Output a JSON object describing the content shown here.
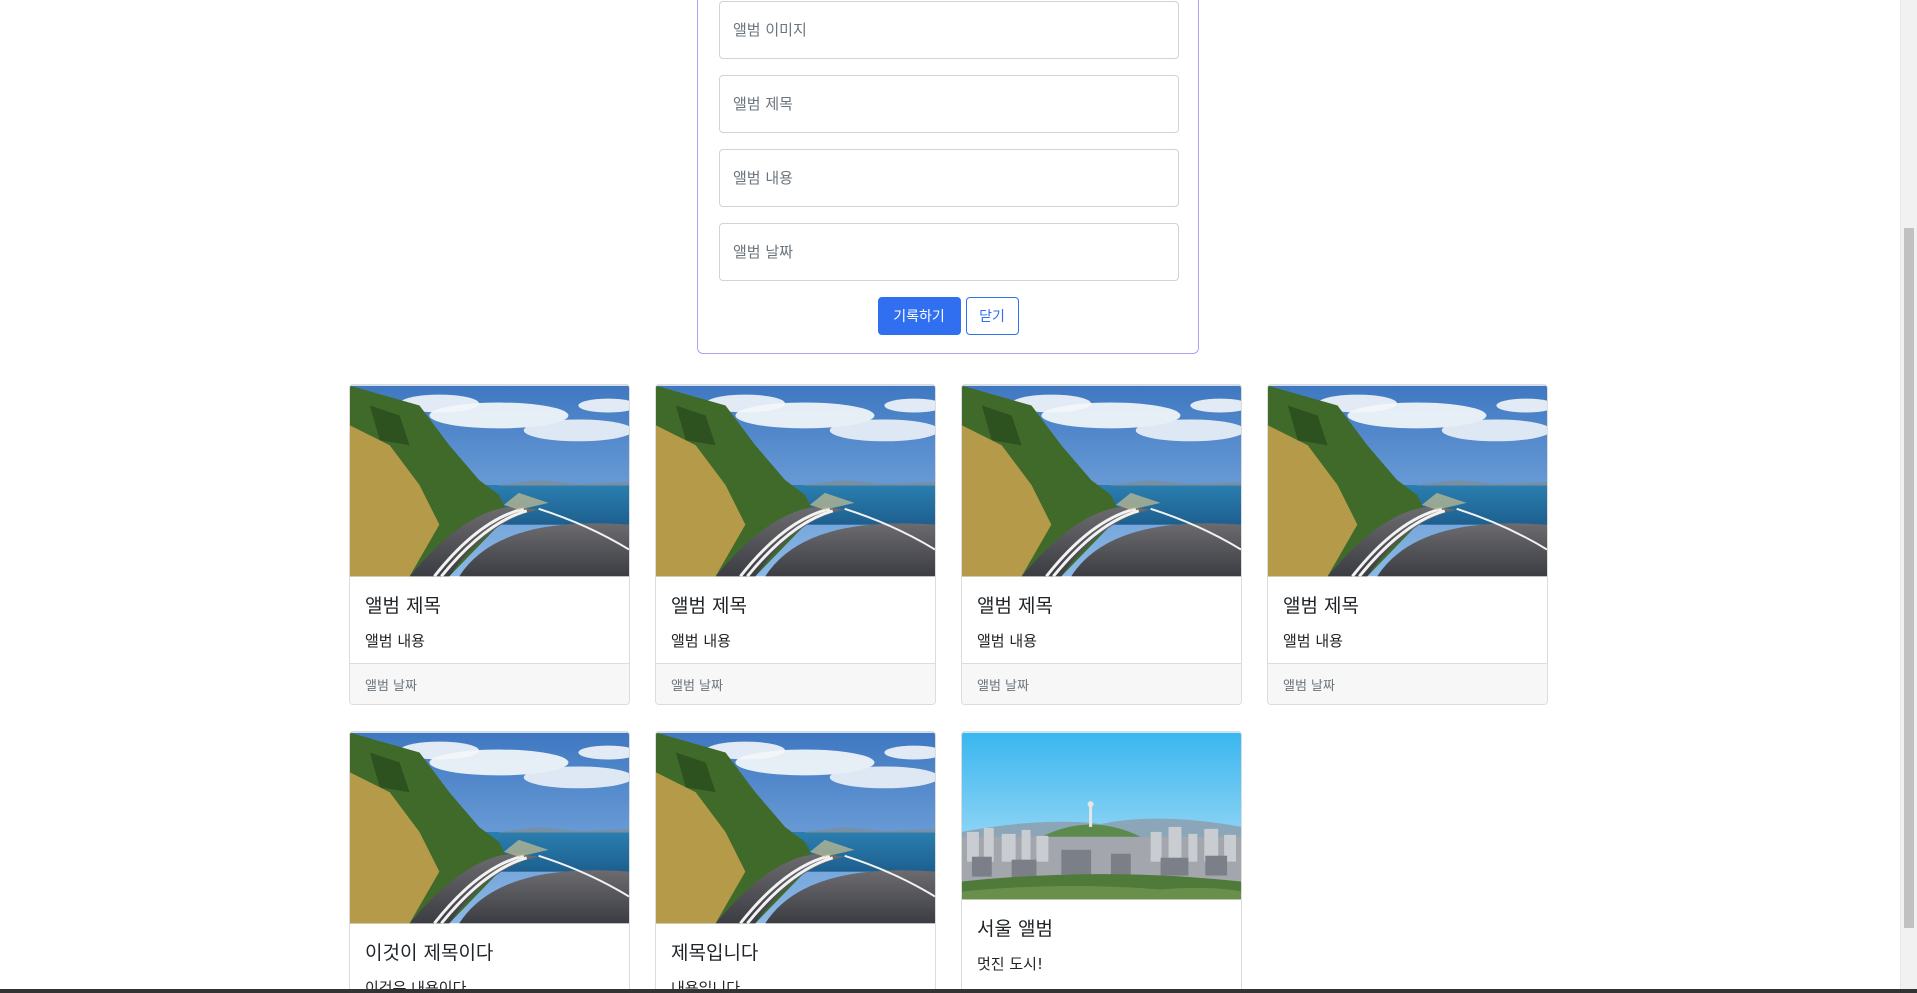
{
  "form": {
    "image_placeholder": "앨범 이미지",
    "title_placeholder": "앨범 제목",
    "content_placeholder": "앨범 내용",
    "date_placeholder": "앨범 날짜",
    "submit_label": "기록하기",
    "close_label": "닫기"
  },
  "cards": [
    {
      "title": "앨범 제목",
      "text": "앨범 내용",
      "date": "앨범 날짜",
      "image": "coastal-road"
    },
    {
      "title": "앨범 제목",
      "text": "앨범 내용",
      "date": "앨범 날짜",
      "image": "coastal-road"
    },
    {
      "title": "앨범 제목",
      "text": "앨범 내용",
      "date": "앨범 날짜",
      "image": "coastal-road"
    },
    {
      "title": "앨범 제목",
      "text": "앨범 내용",
      "date": "앨범 날짜",
      "image": "coastal-road"
    },
    {
      "title": "이것이 제목이다",
      "text": "이것은 내용이다",
      "image": "coastal-road"
    },
    {
      "title": "제목입니다",
      "text": "내용입니다",
      "image": "coastal-road"
    },
    {
      "title": "서울 앨범",
      "text": "멋진 도시!",
      "image": "seoul-city"
    }
  ],
  "colors": {
    "primary": "#2f6ff0",
    "form_border": "#a9a4f3"
  }
}
